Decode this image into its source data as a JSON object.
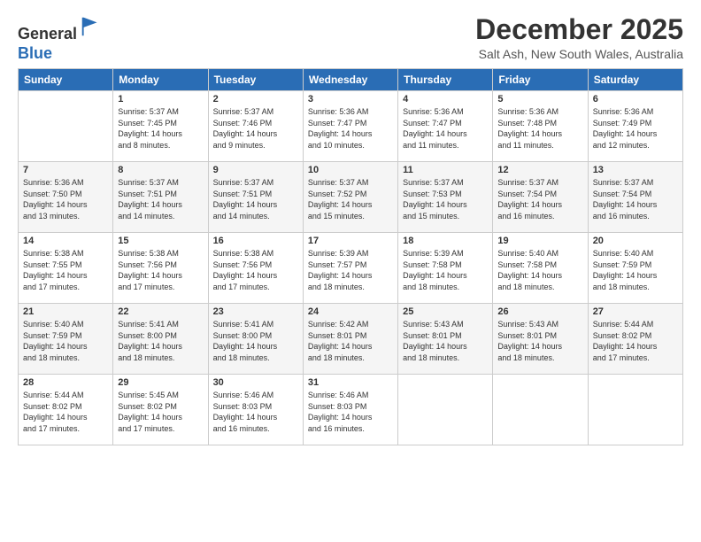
{
  "logo": {
    "general": "General",
    "blue": "Blue"
  },
  "header": {
    "month": "December 2025",
    "location": "Salt Ash, New South Wales, Australia"
  },
  "weekdays": [
    "Sunday",
    "Monday",
    "Tuesday",
    "Wednesday",
    "Thursday",
    "Friday",
    "Saturday"
  ],
  "weeks": [
    [
      {
        "day": "",
        "info": ""
      },
      {
        "day": "1",
        "info": "Sunrise: 5:37 AM\nSunset: 7:45 PM\nDaylight: 14 hours\nand 8 minutes."
      },
      {
        "day": "2",
        "info": "Sunrise: 5:37 AM\nSunset: 7:46 PM\nDaylight: 14 hours\nand 9 minutes."
      },
      {
        "day": "3",
        "info": "Sunrise: 5:36 AM\nSunset: 7:47 PM\nDaylight: 14 hours\nand 10 minutes."
      },
      {
        "day": "4",
        "info": "Sunrise: 5:36 AM\nSunset: 7:47 PM\nDaylight: 14 hours\nand 11 minutes."
      },
      {
        "day": "5",
        "info": "Sunrise: 5:36 AM\nSunset: 7:48 PM\nDaylight: 14 hours\nand 11 minutes."
      },
      {
        "day": "6",
        "info": "Sunrise: 5:36 AM\nSunset: 7:49 PM\nDaylight: 14 hours\nand 12 minutes."
      }
    ],
    [
      {
        "day": "7",
        "info": "Sunrise: 5:36 AM\nSunset: 7:50 PM\nDaylight: 14 hours\nand 13 minutes."
      },
      {
        "day": "8",
        "info": "Sunrise: 5:37 AM\nSunset: 7:51 PM\nDaylight: 14 hours\nand 14 minutes."
      },
      {
        "day": "9",
        "info": "Sunrise: 5:37 AM\nSunset: 7:51 PM\nDaylight: 14 hours\nand 14 minutes."
      },
      {
        "day": "10",
        "info": "Sunrise: 5:37 AM\nSunset: 7:52 PM\nDaylight: 14 hours\nand 15 minutes."
      },
      {
        "day": "11",
        "info": "Sunrise: 5:37 AM\nSunset: 7:53 PM\nDaylight: 14 hours\nand 15 minutes."
      },
      {
        "day": "12",
        "info": "Sunrise: 5:37 AM\nSunset: 7:54 PM\nDaylight: 14 hours\nand 16 minutes."
      },
      {
        "day": "13",
        "info": "Sunrise: 5:37 AM\nSunset: 7:54 PM\nDaylight: 14 hours\nand 16 minutes."
      }
    ],
    [
      {
        "day": "14",
        "info": "Sunrise: 5:38 AM\nSunset: 7:55 PM\nDaylight: 14 hours\nand 17 minutes."
      },
      {
        "day": "15",
        "info": "Sunrise: 5:38 AM\nSunset: 7:56 PM\nDaylight: 14 hours\nand 17 minutes."
      },
      {
        "day": "16",
        "info": "Sunrise: 5:38 AM\nSunset: 7:56 PM\nDaylight: 14 hours\nand 17 minutes."
      },
      {
        "day": "17",
        "info": "Sunrise: 5:39 AM\nSunset: 7:57 PM\nDaylight: 14 hours\nand 18 minutes."
      },
      {
        "day": "18",
        "info": "Sunrise: 5:39 AM\nSunset: 7:58 PM\nDaylight: 14 hours\nand 18 minutes."
      },
      {
        "day": "19",
        "info": "Sunrise: 5:40 AM\nSunset: 7:58 PM\nDaylight: 14 hours\nand 18 minutes."
      },
      {
        "day": "20",
        "info": "Sunrise: 5:40 AM\nSunset: 7:59 PM\nDaylight: 14 hours\nand 18 minutes."
      }
    ],
    [
      {
        "day": "21",
        "info": "Sunrise: 5:40 AM\nSunset: 7:59 PM\nDaylight: 14 hours\nand 18 minutes."
      },
      {
        "day": "22",
        "info": "Sunrise: 5:41 AM\nSunset: 8:00 PM\nDaylight: 14 hours\nand 18 minutes."
      },
      {
        "day": "23",
        "info": "Sunrise: 5:41 AM\nSunset: 8:00 PM\nDaylight: 14 hours\nand 18 minutes."
      },
      {
        "day": "24",
        "info": "Sunrise: 5:42 AM\nSunset: 8:01 PM\nDaylight: 14 hours\nand 18 minutes."
      },
      {
        "day": "25",
        "info": "Sunrise: 5:43 AM\nSunset: 8:01 PM\nDaylight: 14 hours\nand 18 minutes."
      },
      {
        "day": "26",
        "info": "Sunrise: 5:43 AM\nSunset: 8:01 PM\nDaylight: 14 hours\nand 18 minutes."
      },
      {
        "day": "27",
        "info": "Sunrise: 5:44 AM\nSunset: 8:02 PM\nDaylight: 14 hours\nand 17 minutes."
      }
    ],
    [
      {
        "day": "28",
        "info": "Sunrise: 5:44 AM\nSunset: 8:02 PM\nDaylight: 14 hours\nand 17 minutes."
      },
      {
        "day": "29",
        "info": "Sunrise: 5:45 AM\nSunset: 8:02 PM\nDaylight: 14 hours\nand 17 minutes."
      },
      {
        "day": "30",
        "info": "Sunrise: 5:46 AM\nSunset: 8:03 PM\nDaylight: 14 hours\nand 16 minutes."
      },
      {
        "day": "31",
        "info": "Sunrise: 5:46 AM\nSunset: 8:03 PM\nDaylight: 14 hours\nand 16 minutes."
      },
      {
        "day": "",
        "info": ""
      },
      {
        "day": "",
        "info": ""
      },
      {
        "day": "",
        "info": ""
      }
    ]
  ]
}
